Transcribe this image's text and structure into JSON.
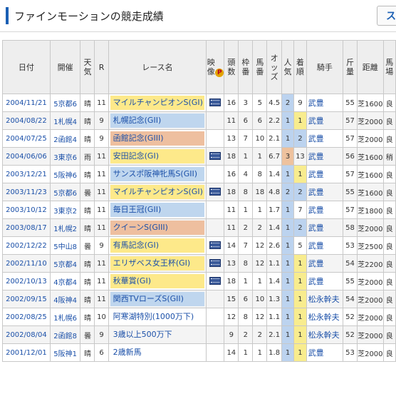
{
  "header": {
    "title": "ファインモーションの競走成績",
    "button_label": "ス"
  },
  "table": {
    "columns": [
      "日付",
      "開催",
      "天気",
      "R",
      "レース名",
      "映像",
      "頭数",
      "枠番",
      "馬番",
      "オッズ",
      "人気",
      "着順",
      "騎手",
      "斤量",
      "距離",
      "馬場"
    ],
    "video_badge": "P",
    "rows": [
      {
        "date": "2004/11/21",
        "course": "5京都6",
        "weather": "晴",
        "r": "11",
        "race": "マイルチャンピオンS(GI)",
        "grade": "g1",
        "video": true,
        "heads": "16",
        "waku": "3",
        "uma": "5",
        "odds": "4.5",
        "pop": "2",
        "fin": "9",
        "jockey": "武豊",
        "kinryo": "55",
        "dist": "芝1600",
        "baba": "良"
      },
      {
        "date": "2004/08/22",
        "course": "1札幌4",
        "weather": "晴",
        "r": "9",
        "race": "札幌記念(GII)",
        "grade": "g2",
        "video": false,
        "heads": "11",
        "waku": "6",
        "uma": "6",
        "odds": "2.2",
        "pop": "1",
        "fin": "1",
        "jockey": "武豊",
        "kinryo": "57",
        "dist": "芝2000",
        "baba": "良"
      },
      {
        "date": "2004/07/25",
        "course": "2函館4",
        "weather": "晴",
        "r": "9",
        "race": "函館記念(GIII)",
        "grade": "g3",
        "video": false,
        "heads": "13",
        "waku": "7",
        "uma": "10",
        "odds": "2.1",
        "pop": "1",
        "fin": "2",
        "jockey": "武豊",
        "kinryo": "57",
        "dist": "芝2000",
        "baba": "良"
      },
      {
        "date": "2004/06/06",
        "course": "3東京6",
        "weather": "雨",
        "r": "11",
        "race": "安田記念(GI)",
        "grade": "g1",
        "video": true,
        "heads": "18",
        "waku": "1",
        "uma": "1",
        "odds": "6.7",
        "pop": "3",
        "fin": "13",
        "jockey": "武豊",
        "kinryo": "56",
        "dist": "芝1600",
        "baba": "稍"
      },
      {
        "date": "2003/12/21",
        "course": "5阪神6",
        "weather": "晴",
        "r": "11",
        "race": "サンスポ阪神牝馬S(GII)",
        "grade": "g2",
        "video": false,
        "heads": "16",
        "waku": "4",
        "uma": "8",
        "odds": "1.4",
        "pop": "1",
        "fin": "1",
        "jockey": "武豊",
        "kinryo": "57",
        "dist": "芝1600",
        "baba": "良"
      },
      {
        "date": "2003/11/23",
        "course": "5京都6",
        "weather": "曇",
        "r": "11",
        "race": "マイルチャンピオンS(GI)",
        "grade": "g1",
        "video": true,
        "heads": "18",
        "waku": "8",
        "uma": "18",
        "odds": "4.8",
        "pop": "2",
        "fin": "2",
        "jockey": "武豊",
        "kinryo": "55",
        "dist": "芝1600",
        "baba": "良"
      },
      {
        "date": "2003/10/12",
        "course": "3東京2",
        "weather": "晴",
        "r": "11",
        "race": "毎日王冠(GII)",
        "grade": "g2",
        "video": false,
        "heads": "11",
        "waku": "1",
        "uma": "1",
        "odds": "1.7",
        "pop": "1",
        "fin": "7",
        "jockey": "武豊",
        "kinryo": "57",
        "dist": "芝1800",
        "baba": "良"
      },
      {
        "date": "2003/08/17",
        "course": "1札幌2",
        "weather": "晴",
        "r": "11",
        "race": "クイーンS(GIII)",
        "grade": "g3",
        "video": false,
        "heads": "11",
        "waku": "2",
        "uma": "2",
        "odds": "1.4",
        "pop": "1",
        "fin": "2",
        "jockey": "武豊",
        "kinryo": "58",
        "dist": "芝2000",
        "baba": "良"
      },
      {
        "date": "2002/12/22",
        "course": "5中山8",
        "weather": "曇",
        "r": "9",
        "race": "有馬記念(GI)",
        "grade": "g1",
        "video": true,
        "heads": "14",
        "waku": "7",
        "uma": "12",
        "odds": "2.6",
        "pop": "1",
        "fin": "5",
        "jockey": "武豊",
        "kinryo": "53",
        "dist": "芝2500",
        "baba": "良"
      },
      {
        "date": "2002/11/10",
        "course": "5京都4",
        "weather": "晴",
        "r": "11",
        "race": "エリザベス女王杯(GI)",
        "grade": "g1",
        "video": true,
        "heads": "13",
        "waku": "8",
        "uma": "12",
        "odds": "1.1",
        "pop": "1",
        "fin": "1",
        "jockey": "武豊",
        "kinryo": "54",
        "dist": "芝2200",
        "baba": "良"
      },
      {
        "date": "2002/10/13",
        "course": "4京都4",
        "weather": "晴",
        "r": "11",
        "race": "秋華賞(GI)",
        "grade": "g1",
        "video": true,
        "heads": "18",
        "waku": "1",
        "uma": "1",
        "odds": "1.4",
        "pop": "1",
        "fin": "1",
        "jockey": "武豊",
        "kinryo": "55",
        "dist": "芝2000",
        "baba": "良"
      },
      {
        "date": "2002/09/15",
        "course": "4阪神4",
        "weather": "晴",
        "r": "11",
        "race": "関西TVローズS(GII)",
        "grade": "g2",
        "video": false,
        "heads": "15",
        "waku": "6",
        "uma": "10",
        "odds": "1.3",
        "pop": "1",
        "fin": "1",
        "jockey": "松永幹夫",
        "kinryo": "54",
        "dist": "芝2000",
        "baba": "良"
      },
      {
        "date": "2002/08/25",
        "course": "1札幌6",
        "weather": "晴",
        "r": "10",
        "race": "阿寒湖特別(1000万下)",
        "grade": "plain",
        "video": false,
        "heads": "12",
        "waku": "8",
        "uma": "12",
        "odds": "1.1",
        "pop": "1",
        "fin": "1",
        "jockey": "松永幹夫",
        "kinryo": "52",
        "dist": "芝2000",
        "baba": "良"
      },
      {
        "date": "2002/08/04",
        "course": "2函館8",
        "weather": "曇",
        "r": "9",
        "race": "3歳以上500万下",
        "grade": "plain",
        "video": false,
        "heads": "9",
        "waku": "2",
        "uma": "2",
        "odds": "2.1",
        "pop": "1",
        "fin": "1",
        "jockey": "松永幹夫",
        "kinryo": "52",
        "dist": "芝2000",
        "baba": "良"
      },
      {
        "date": "2001/12/01",
        "course": "5阪神1",
        "weather": "晴",
        "r": "6",
        "race": "2歳新馬",
        "grade": "plain",
        "video": false,
        "heads": "14",
        "waku": "1",
        "uma": "1",
        "odds": "1.8",
        "pop": "1",
        "fin": "1",
        "jockey": "武豊",
        "kinryo": "53",
        "dist": "芝2000",
        "baba": "良"
      }
    ]
  }
}
